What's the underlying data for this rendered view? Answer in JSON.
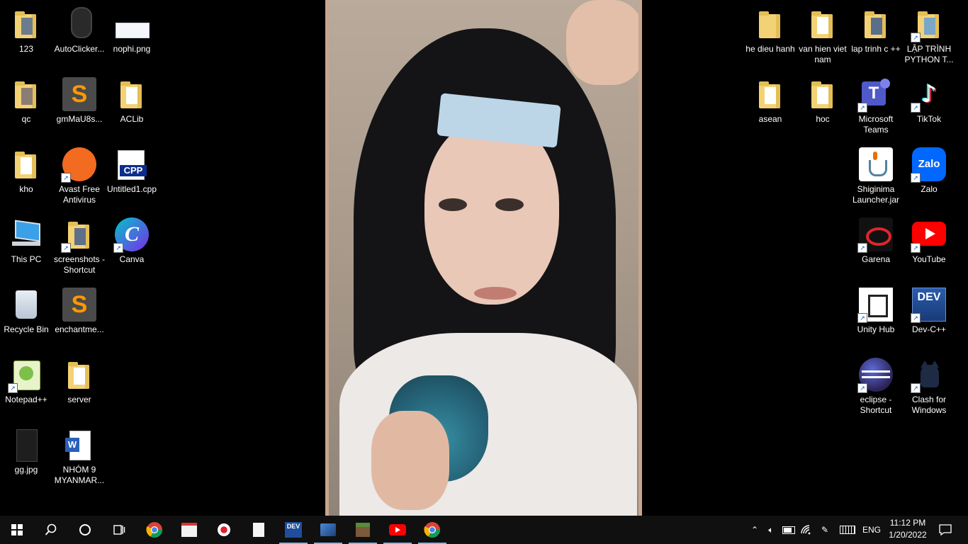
{
  "desktop": {
    "left_icons": [
      {
        "label": "123"
      },
      {
        "label": "AutoClicker..."
      },
      {
        "label": "nophi.png"
      },
      {
        "label": "qc"
      },
      {
        "label": "gmMaU8s..."
      },
      {
        "label": "ACLib"
      },
      {
        "label": "kho"
      },
      {
        "label": "Avast Free Antivirus"
      },
      {
        "label": "Untitled1.cpp"
      },
      {
        "label": "This PC"
      },
      {
        "label": "screenshots - Shortcut"
      },
      {
        "label": "Canva"
      },
      {
        "label": "Recycle Bin"
      },
      {
        "label": "enchantme..."
      },
      {
        "label": "Notepad++"
      },
      {
        "label": "server"
      },
      {
        "label": "gg.jpg"
      },
      {
        "label": "NHÓM 9 MYANMAR..."
      }
    ],
    "right_icons": [
      {
        "label": "he dieu hanh"
      },
      {
        "label": "van hien viet nam"
      },
      {
        "label": "lap trinh c ++"
      },
      {
        "label": "LẬP TRÌNH PYTHON T..."
      },
      {
        "label": "asean"
      },
      {
        "label": "hoc"
      },
      {
        "label": "Microsoft Teams"
      },
      {
        "label": "TikTok"
      },
      {
        "label": "Shiginima Launcher.jar"
      },
      {
        "label": "Zalo"
      },
      {
        "label": "Garena"
      },
      {
        "label": "YouTube"
      },
      {
        "label": "Unity Hub"
      },
      {
        "label": "Dev-C++"
      },
      {
        "label": "eclipse - Shortcut"
      },
      {
        "label": "Clash for Windows"
      }
    ],
    "icon_text": {
      "cpp": "CPP",
      "dev": "DEV",
      "zalo": "Zalo",
      "sublime": "S",
      "canva": "C",
      "teams": "T",
      "word": "W"
    }
  },
  "taskbar": {
    "pinned": [
      {
        "name": "start-button"
      },
      {
        "name": "search-button"
      },
      {
        "name": "cortana-button"
      },
      {
        "name": "task-view-button"
      },
      {
        "name": "chrome-taskbar-button"
      },
      {
        "name": "app-taskbar-button"
      },
      {
        "name": "recorder-taskbar-button"
      },
      {
        "name": "file-taskbar-button"
      },
      {
        "name": "devcpp-taskbar-button"
      },
      {
        "name": "network-app-taskbar-button"
      },
      {
        "name": "minecraft-taskbar-button"
      },
      {
        "name": "youtube-taskbar-button"
      },
      {
        "name": "chrome-profile-taskbar-button"
      }
    ],
    "dev_label": "DEV",
    "tray": {
      "language": "ENG",
      "time": "11:12 PM",
      "date": "1/20/2022"
    }
  },
  "colors": {
    "taskbar_bg": "#101010",
    "active_indicator": "#76b9ed",
    "folder": "#f3d275"
  }
}
